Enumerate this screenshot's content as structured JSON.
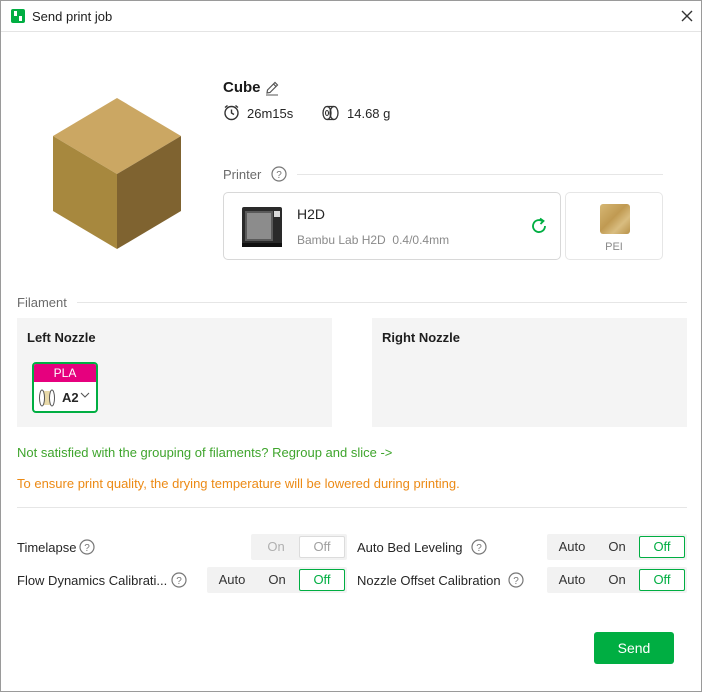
{
  "window": {
    "title": "Send print job"
  },
  "job": {
    "name": "Cube",
    "time": "26m15s",
    "weight": "14.68 g"
  },
  "printer_section": {
    "label": "Printer"
  },
  "printer": {
    "name": "H2D",
    "model": "Bambu Lab H2D",
    "nozzles": "0.4/0.4mm"
  },
  "plate": {
    "label": "PEI"
  },
  "filament_section": {
    "label": "Filament"
  },
  "left_nozzle": {
    "title": "Left Nozzle",
    "filament": {
      "type": "PLA",
      "slot": "A2",
      "color": "#e6007e"
    }
  },
  "right_nozzle": {
    "title": "Right Nozzle"
  },
  "messages": {
    "regroup": "Not satisfied with the grouping of filaments? Regroup and slice ->",
    "drying": "To ensure print quality, the drying temperature will be lowered during printing."
  },
  "options": {
    "timelapse": {
      "label": "Timelapse",
      "choices": [
        "On",
        "Off"
      ],
      "selected": "Off"
    },
    "bed_leveling": {
      "label": "Auto Bed Leveling",
      "choices": [
        "Auto",
        "On",
        "Off"
      ],
      "selected": "Off"
    },
    "flow_dynamics": {
      "label": "Flow Dynamics Calibrati...",
      "choices": [
        "Auto",
        "On",
        "Off"
      ],
      "selected": "Off"
    },
    "nozzle_offset": {
      "label": "Nozzle Offset Calibration",
      "choices": [
        "Auto",
        "On",
        "Off"
      ],
      "selected": "Off"
    }
  },
  "send_button": {
    "label": "Send"
  },
  "colors": {
    "accent": "#00ae42",
    "regroup_text": "#3fa52d",
    "warning_text": "#ec8a15",
    "cube": "#c9a85c"
  },
  "icons": [
    "app-icon",
    "close-icon",
    "edit-icon",
    "clock-icon",
    "spool-icon",
    "help-icon",
    "printer-icon",
    "refresh-icon"
  ]
}
